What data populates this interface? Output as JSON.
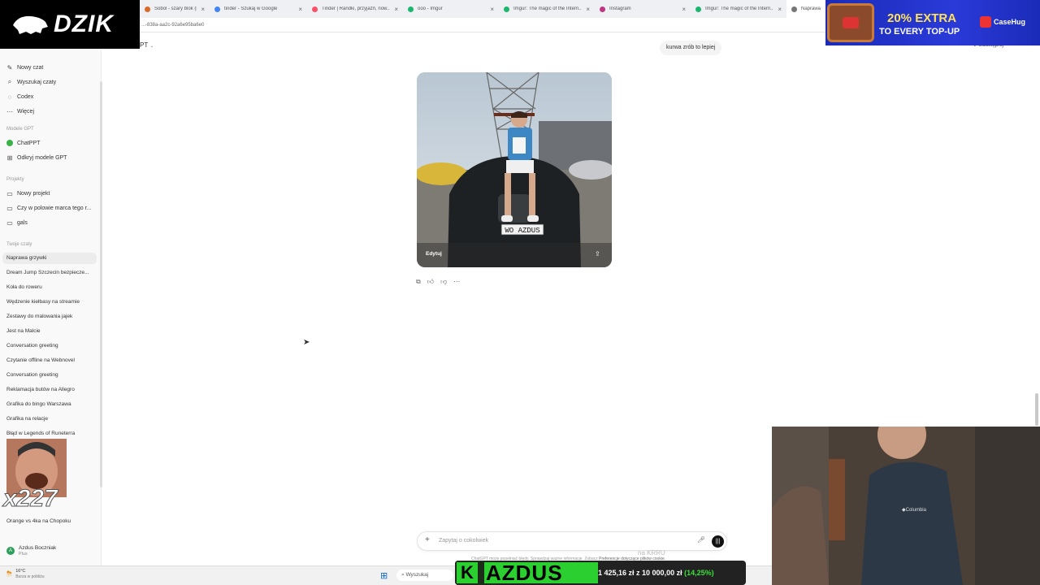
{
  "browser": {
    "tabs": [
      {
        "label": "Sobol - szary blok (k..",
        "color": "#d86b2b"
      },
      {
        "label": "tinder - Szukaj w Google",
        "color": "#4285f4"
      },
      {
        "label": "Tinder | Randki, przyjaźń, now...",
        "color": "#fd5068"
      },
      {
        "label": "ooo - Imgur",
        "color": "#1bb76e"
      },
      {
        "label": "Imgur: The magic of the Intern...",
        "color": "#1bb76e"
      },
      {
        "label": "Instagram",
        "color": "#c13584"
      },
      {
        "label": "Imgur: The magic of the Intern...",
        "color": "#1bb76e"
      },
      {
        "label": "Naprawa g...",
        "color": "#777777"
      }
    ],
    "url": "...-838a-aa2c-92a6e95ba6e0"
  },
  "sidebar": {
    "top_items": [
      {
        "label": "Nowy czat",
        "icon": "edit-icon"
      },
      {
        "label": "Wyszukaj czaty",
        "icon": "search-icon"
      },
      {
        "label": "Codex",
        "icon": "codex-icon"
      },
      {
        "label": "Więcej",
        "icon": "more-icon"
      }
    ],
    "gpt_heading": "Modele GPT",
    "gpt_items": [
      {
        "label": "ChatPPT",
        "icon": "gpt-avatar-icon"
      },
      {
        "label": "Odkryj modele GPT",
        "icon": "grid-icon"
      }
    ],
    "projects_heading": "Projekty",
    "projects": [
      {
        "label": "Nowy projekt",
        "icon": "new-folder-icon"
      },
      {
        "label": "Czy w polowie marca tego r...",
        "icon": "folder-icon"
      },
      {
        "label": "gals",
        "icon": "folder-icon"
      }
    ],
    "chats_heading": "Twoje czaty",
    "chats": [
      "Naprawa grzywki",
      "Dream Jump Szczecin bezpiecze...",
      "Koła do roweru",
      "Wędzenie kiełbasy na streamie",
      "Zestawy do malowania jajek",
      "Jest na Malcie",
      "Conversation greeting",
      "Czytanie offline na Webnovel",
      "Conversation greeting",
      "Reklamacja butów na Allegro",
      "Grafika do bingo Warszawa",
      "Grafika na relacje",
      "Błąd w Legends of Runeterra"
    ],
    "lower_chats": [
      "Orange vs 4ka na Chopoku"
    ],
    "user_name": "Azdus Boczniak",
    "user_plan": "Plus"
  },
  "main": {
    "model_label": "PT",
    "user_message": "kurwa zrób to lepiej",
    "share_label": "Udostępnij",
    "image_edit_label": "Edytuj",
    "plate_text": "WO AZDUS",
    "composer_placeholder": "Zapytaj o cokolwiek",
    "disclaimer": "ChatGPT może popełniać błędy. Sprawdzaj ważne informacje. Zobacz",
    "disclaimer_link": "Preferencje dotyczące plików cookie."
  },
  "taskbar": {
    "temp": "16°C",
    "weather_desc": "Burza w pobliżu",
    "search_label": "Wyszukaj"
  },
  "overlays": {
    "brand": "DZIK",
    "ad_line1": "20% EXTRA",
    "ad_line2": "TO EVERY TOP-UP",
    "ad_brand": "CaseHug",
    "emote_count": "x227",
    "goal_k": "K",
    "goal_name": "AZDUS",
    "goal_text": "1 425,16 zł z 10 000,00 zł",
    "goal_percent": "(14,25%)",
    "goal_fraction": 0.1425,
    "watermark": "na KRRU"
  },
  "colors": {
    "accent": "#2ccf30",
    "ad_bg": "#1b2bb8"
  }
}
